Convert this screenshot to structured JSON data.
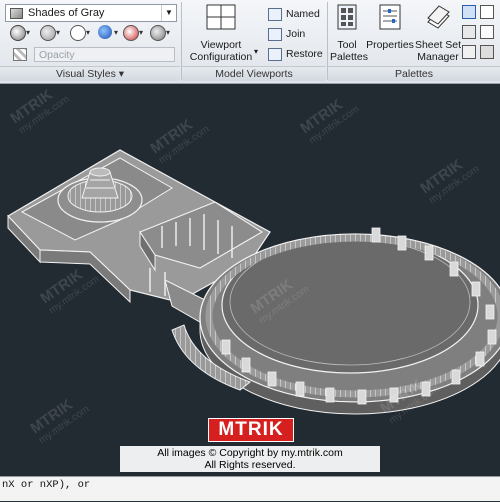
{
  "ribbon": {
    "visual_styles": {
      "current_style": "Shades of Gray",
      "opacity_placeholder": "Opacity",
      "panel_title": "Visual Styles",
      "panel_caret": "▾"
    },
    "model_viewports": {
      "viewport_config_label_line1": "Viewport",
      "viewport_config_label_line2": "Configuration",
      "named_label": "Named",
      "join_label": "Join",
      "restore_label": "Restore",
      "panel_title": "Model Viewports"
    },
    "palettes": {
      "tool_palettes_line1": "Tool",
      "tool_palettes_line2": "Palettes",
      "properties_label": "Properties",
      "sheet_set_line1": "Sheet Set",
      "sheet_set_line2": "Manager",
      "panel_title": "Palettes"
    }
  },
  "command_line": {
    "line1": "nX or nXP), or",
    "line2": "                    "
  },
  "watermark": {
    "brand": "MTRIK",
    "site": "my.mtrik.com",
    "copyright_line1": "All images © Copyright by my.mtrik.com",
    "copyright_line2": "All Rights reserved."
  },
  "colors": {
    "viewport_bg": "#222a32",
    "model_face": "#8e8e8e",
    "model_edge": "#f2f2f2",
    "logo_red": "#d61f1f"
  }
}
